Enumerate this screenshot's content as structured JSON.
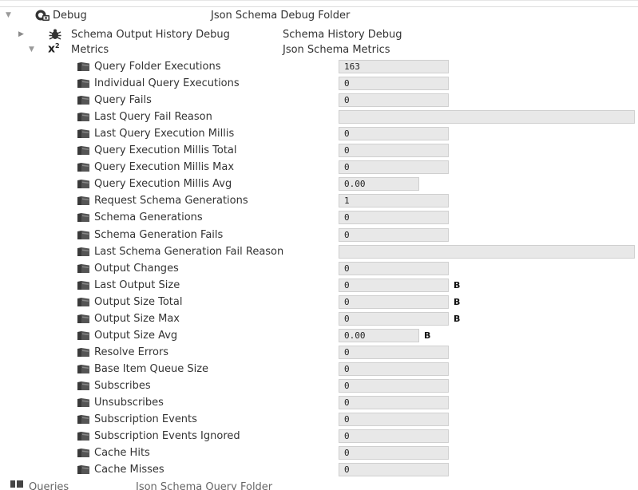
{
  "tree": {
    "debug": {
      "label": "Debug",
      "type": "Json Schema Debug Folder"
    },
    "history": {
      "label": "Schema Output History Debug",
      "type": "Schema History Debug"
    },
    "metrics": {
      "label": "Metrics",
      "type": "Json Schema Metrics"
    },
    "queries": {
      "label": "Queries",
      "type": "Json Schema Query Folder"
    }
  },
  "properties": [
    {
      "label": "Query Folder Executions",
      "value": "163",
      "size": "std",
      "unit": ""
    },
    {
      "label": "Individual Query Executions",
      "value": "0",
      "size": "std",
      "unit": ""
    },
    {
      "label": "Query Fails",
      "value": "0",
      "size": "std",
      "unit": ""
    },
    {
      "label": "Last Query Fail Reason",
      "value": "",
      "size": "wide",
      "unit": ""
    },
    {
      "label": "Last Query Execution Millis",
      "value": "0",
      "size": "std",
      "unit": ""
    },
    {
      "label": "Query Execution Millis Total",
      "value": "0",
      "size": "std",
      "unit": ""
    },
    {
      "label": "Query Execution Millis Max",
      "value": "0",
      "size": "std",
      "unit": ""
    },
    {
      "label": "Query Execution Millis Avg",
      "value": "0.00",
      "size": "short",
      "unit": ""
    },
    {
      "label": "Request Schema Generations",
      "value": "1",
      "size": "std",
      "unit": ""
    },
    {
      "label": "Schema Generations",
      "value": "0",
      "size": "std",
      "unit": ""
    },
    {
      "label": "Schema Generation Fails",
      "value": "0",
      "size": "std",
      "unit": ""
    },
    {
      "label": "Last Schema Generation Fail Reason",
      "value": "",
      "size": "wide",
      "unit": ""
    },
    {
      "label": "Output Changes",
      "value": "0",
      "size": "std",
      "unit": ""
    },
    {
      "label": "Last Output Size",
      "value": "0",
      "size": "std",
      "unit": "B"
    },
    {
      "label": "Output Size Total",
      "value": "0",
      "size": "std",
      "unit": "B"
    },
    {
      "label": "Output Size Max",
      "value": "0",
      "size": "std",
      "unit": "B"
    },
    {
      "label": "Output Size Avg",
      "value": "0.00",
      "size": "short",
      "unit": "B"
    },
    {
      "label": "Resolve Errors",
      "value": "0",
      "size": "std",
      "unit": ""
    },
    {
      "label": "Base Item Queue Size",
      "value": "0",
      "size": "std",
      "unit": ""
    },
    {
      "label": "Subscribes",
      "value": "0",
      "size": "std",
      "unit": ""
    },
    {
      "label": "Unsubscribes",
      "value": "0",
      "size": "std",
      "unit": ""
    },
    {
      "label": "Subscription Events",
      "value": "0",
      "size": "std",
      "unit": ""
    },
    {
      "label": "Subscription Events Ignored",
      "value": "0",
      "size": "std",
      "unit": ""
    },
    {
      "label": "Cache Hits",
      "value": "0",
      "size": "std",
      "unit": ""
    },
    {
      "label": "Cache Misses",
      "value": "0",
      "size": "std",
      "unit": ""
    }
  ],
  "icons": {
    "debug": "debug-folder-icon",
    "history": "bug-icon",
    "metrics": "x-squared-icon",
    "property": "folder-property-icon",
    "queries": "query-folder-icon"
  }
}
